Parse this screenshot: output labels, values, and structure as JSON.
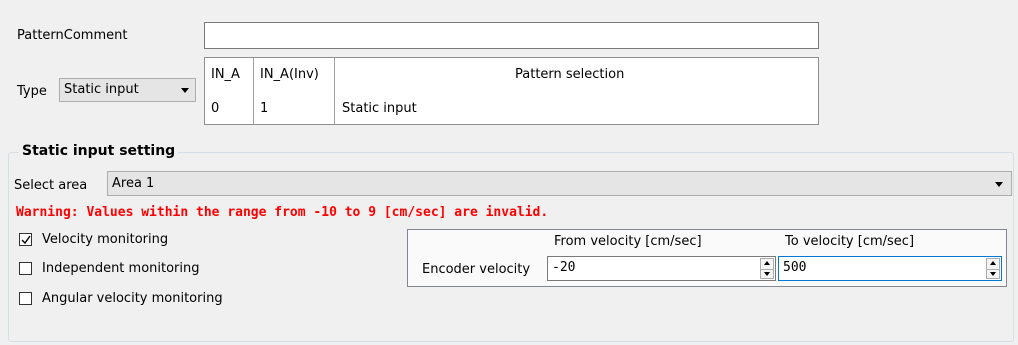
{
  "pattern_comment": {
    "label": "PatternComment",
    "value": ""
  },
  "type": {
    "label": "Type",
    "selected": "Static input"
  },
  "pattern_table": {
    "headers": [
      "IN_A",
      "IN_A(Inv)",
      "Pattern selection"
    ],
    "row": [
      "0",
      "1",
      "Static input"
    ]
  },
  "static_input_setting": {
    "title": "Static input setting",
    "select_area_label": "Select area",
    "select_area_value": "Area 1",
    "warning": "Warning: Values within the range from -10 to 9 [cm/sec] are invalid.",
    "checkboxes": [
      {
        "label": "Velocity monitoring",
        "checked": true
      },
      {
        "label": "Independent monitoring",
        "checked": false
      },
      {
        "label": "Angular velocity monitoring",
        "checked": false
      }
    ],
    "velocity": {
      "from_header": "From velocity [cm/sec]",
      "to_header": "To velocity [cm/sec]",
      "row_label": "Encoder velocity",
      "from_value": "-20",
      "to_value": "500"
    }
  },
  "colors": {
    "warning": "#ff0000",
    "focus_border": "#0078d7"
  }
}
